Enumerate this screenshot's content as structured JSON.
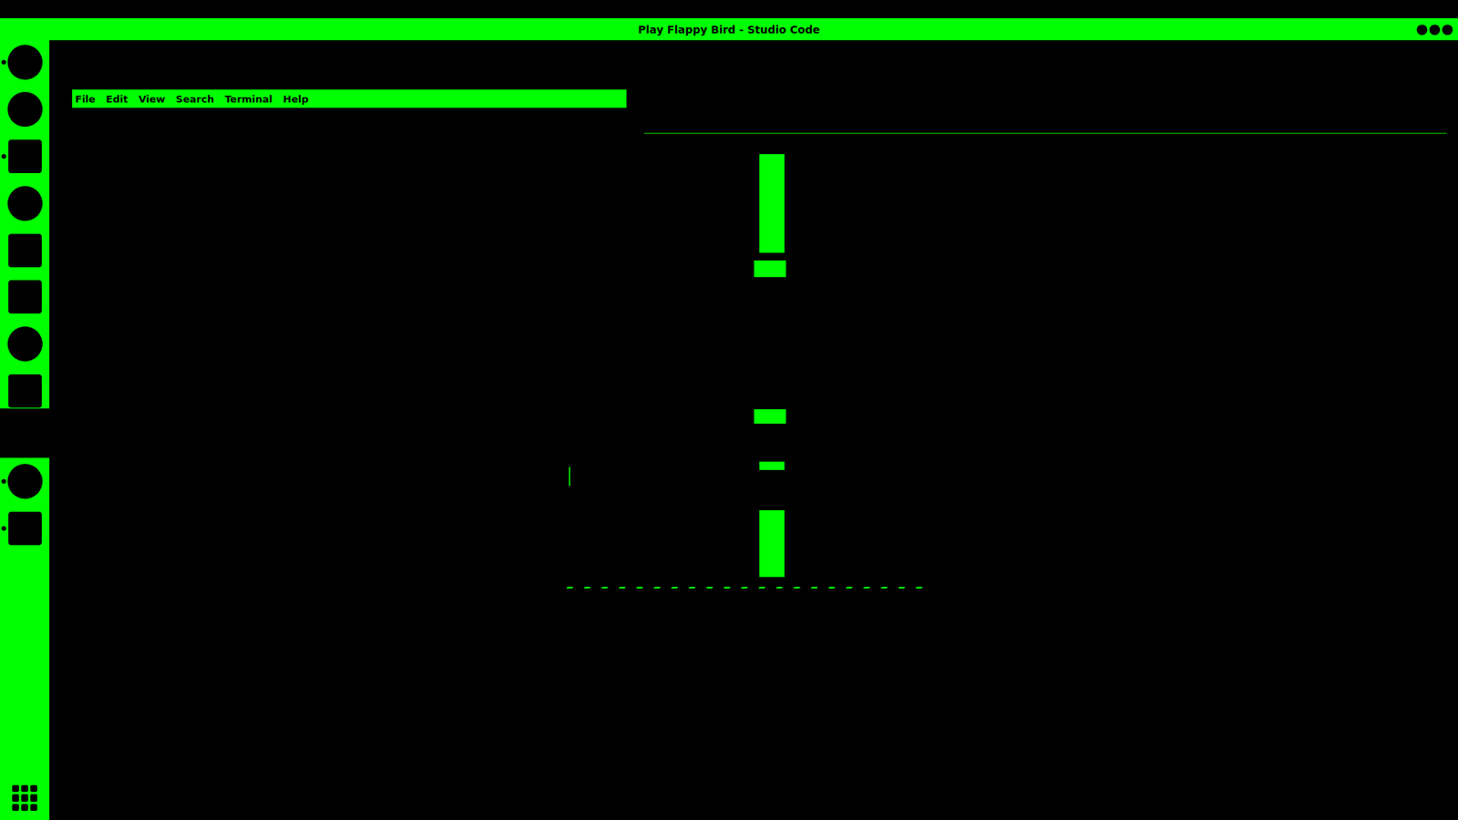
{
  "window": {
    "title": "Play Flappy Bird - Studio Code"
  },
  "top_bar": {
    "indicators": [
      "●",
      "●",
      "●"
    ]
  },
  "menu": [
    "File",
    "Edit",
    "View",
    "Search",
    "Terminal",
    "Help"
  ],
  "dock": {
    "upper": [
      {
        "kind": "round",
        "running": true
      },
      {
        "kind": "round",
        "running": false
      },
      {
        "kind": "square",
        "running": true
      },
      {
        "kind": "round",
        "running": false
      },
      {
        "kind": "square",
        "running": false
      },
      {
        "kind": "square",
        "running": false
      },
      {
        "kind": "round",
        "running": false
      },
      {
        "kind": "square",
        "running": false
      }
    ],
    "lower": [
      {
        "kind": "round",
        "running": true
      },
      {
        "kind": "square",
        "running": true
      }
    ]
  }
}
